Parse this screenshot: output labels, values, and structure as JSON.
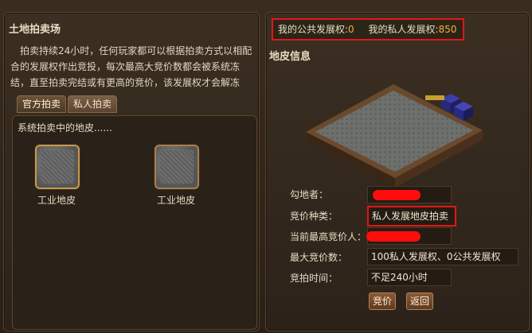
{
  "auction": {
    "title": "土地拍卖场",
    "description": "拍卖持续24小时，任何玩家都可以根据拍卖方式以相配合的发展权作出竞投，每次最高大竞价数都会被系统冻结，直至拍卖完结或有更高的竞价，该发展权才会解冻",
    "tabs": [
      {
        "label": "官方拍卖",
        "active": true
      },
      {
        "label": "私人拍卖",
        "active": false
      }
    ],
    "list_header": "系统拍卖中的地皮......",
    "plots": [
      {
        "label": "工业地皮",
        "highlight": "gold"
      },
      {
        "label": "工业地皮",
        "highlight": "bronze"
      }
    ]
  },
  "resources": {
    "public_label": "我的公共发展权:",
    "public_value": "0",
    "private_label": "我的私人发展权:",
    "private_value": "850"
  },
  "plot_info": {
    "title": "地皮信息",
    "fields": [
      {
        "label": "勾地者：",
        "value": "",
        "redacted": true
      },
      {
        "label": "竞价种类：",
        "value": "私人发展地皮拍卖",
        "highlight": true
      },
      {
        "label": "当前最高竞价人：",
        "value": "",
        "redacted": true
      },
      {
        "label": "最大竞价数：",
        "value": "100私人发展权、0公共发展权"
      },
      {
        "label": "竞拍时间：",
        "value": "不足240小时"
      }
    ],
    "buttons": {
      "bid": "竞价",
      "back": "返回"
    }
  },
  "colors": {
    "accent_gold": "#c89a48",
    "redaction": "#ff0d0d",
    "highlight_border": "#e01818",
    "value_orange": "#f2b03a"
  }
}
